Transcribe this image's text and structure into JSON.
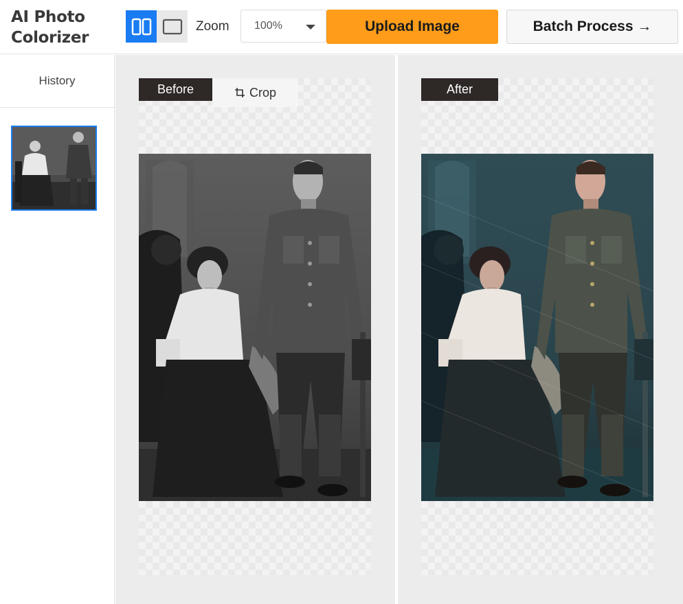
{
  "header": {
    "title": "AI Photo Colorizer",
    "zoom_label": "Zoom",
    "zoom_value": "100%",
    "upload_label": "Upload Image",
    "batch_label": "Batch Process →"
  },
  "sidebar": {
    "history_label": "History"
  },
  "comparison": {
    "before_label": "Before",
    "crop_label": "Crop",
    "after_label": "After"
  },
  "icons": {
    "split_view": "split-view-icon",
    "single_view": "single-view-icon",
    "crop": "crop-icon",
    "dropdown": "chevron-down-icon"
  },
  "colors": {
    "accent_blue": "#1a7cf2",
    "upload_orange": "#ff9c1a",
    "tag_dark": "#2e2826",
    "panel_bg": "#ececec"
  }
}
